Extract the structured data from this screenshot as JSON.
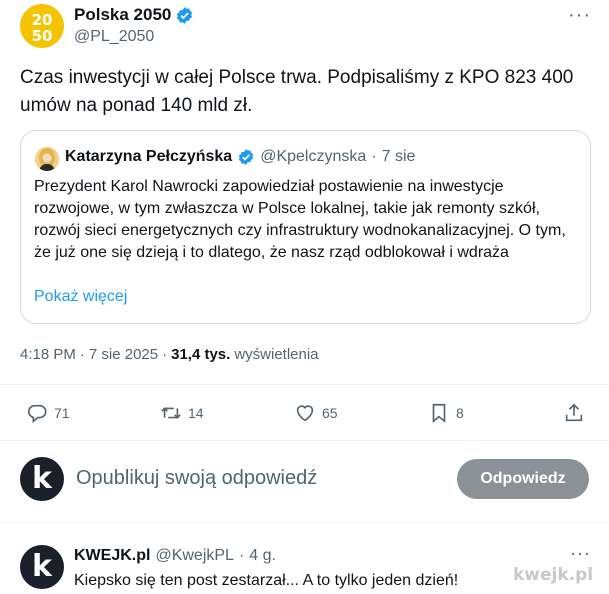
{
  "tweet": {
    "author_name": "Polska 2050",
    "author_handle": "@PL_2050",
    "avatar_text": "2050",
    "more_glyph": "···",
    "text": "Czas inwestycji w całej Polsce trwa. Podpisaliśmy z KPO 823 400 umów na ponad 140 mld zł."
  },
  "quote": {
    "author_name": "Katarzyna Pełczyńska",
    "author_handle": "@Kpelczynska",
    "separator": "·",
    "time": "7 sie",
    "text": "Prezydent Karol Nawrocki zapowiedział postawienie na inwestycje rozwojowe, w tym zwłaszcza w Polsce lokalnej, takie jak remonty szkół, rozwój sieci energetycznych czy infrastruktury wodnokanalizacyjnej.  O tym, że już one się dzieją i to dlatego, że nasz rząd odblokował i wdraża",
    "show_more": "Pokaż więcej"
  },
  "meta": {
    "time": "4:18 PM",
    "sep1": "·",
    "date": "7 sie 2025",
    "sep2": "·",
    "views_count": "31,4 tys.",
    "views_label": "wyświetlenia"
  },
  "actions": {
    "replies": "71",
    "reposts": "14",
    "likes": "65",
    "bookmarks": "8",
    "icons": [
      "reply-icon",
      "repost-icon",
      "like-icon",
      "bookmark-icon",
      "share-icon"
    ]
  },
  "composer": {
    "avatar_letter": "k",
    "placeholder": "Opublikuj swoją odpowiedź",
    "button_label": "Odpowiedz"
  },
  "reply": {
    "author_name": "KWEJK.pl",
    "author_handle": "@KwejkPL",
    "separator": "·",
    "time": "4 g.",
    "avatar_letter": "k",
    "more_glyph": "···",
    "text": "Kiepsko się ten post zestarzał... A to tylko jeden dzień!"
  },
  "watermark": "kwejk.pl",
  "colors": {
    "verified": "#1d9bf0",
    "link": "#1d9bf0",
    "muted": "#536471",
    "button_bg": "#8b9196",
    "brand_yellow": "#f5c400"
  }
}
